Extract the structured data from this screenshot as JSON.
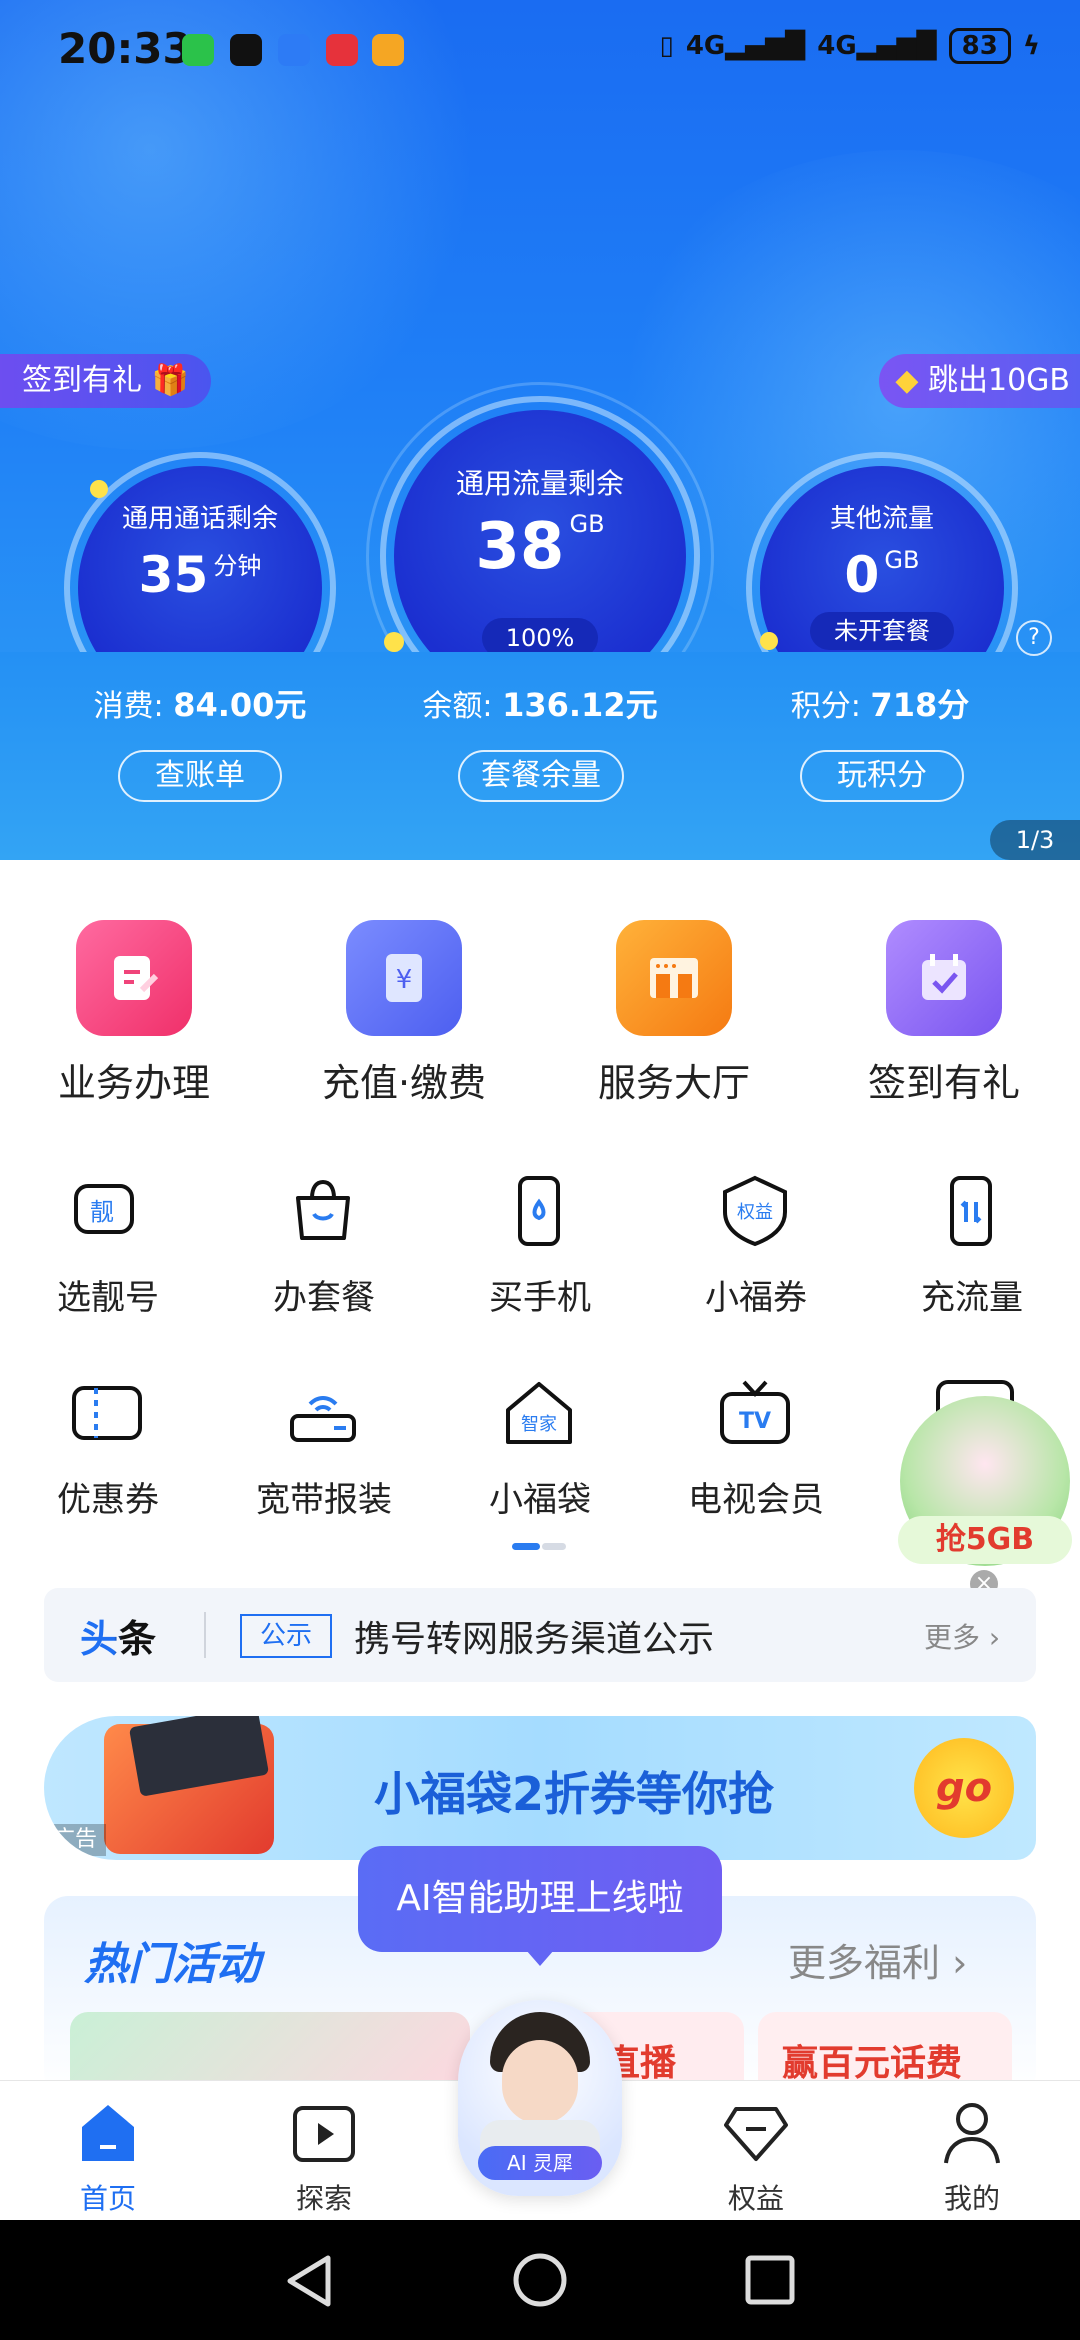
{
  "status_bar": {
    "time": "20:33",
    "net1": "4G",
    "net2": "4G",
    "battery": "83"
  },
  "hero": {
    "checkin_pill": "签到有礼",
    "jump_pill": "跳出10GB",
    "gauges": [
      {
        "title": "通用通话剩余",
        "value": "35",
        "unit": "分钟",
        "stat_label": "消费:",
        "stat_value": "84.00元",
        "button": "查账单"
      },
      {
        "title": "通用流量剩余",
        "value": "38",
        "unit": "GB",
        "badge": "100%",
        "stat_label": "余额:",
        "stat_value": "136.12元",
        "button": "套餐余量"
      },
      {
        "title": "其他流量",
        "value": "0",
        "unit": "GB",
        "badge": "未开套餐",
        "stat_label": "积分:",
        "stat_value": "718分",
        "button": "玩积分"
      }
    ],
    "pager": "1/3",
    "help": "?"
  },
  "main_services": [
    {
      "label": "业务办理",
      "icon": "edit-doc-icon",
      "color": "#f0447a"
    },
    {
      "label": "充值·缴费",
      "icon": "yen-card-icon",
      "color": "#6a7cf5"
    },
    {
      "label": "服务大厅",
      "icon": "store-icon",
      "color": "#f58a1e"
    },
    {
      "label": "签到有礼",
      "icon": "calendar-check-icon",
      "color": "#8b6af2"
    }
  ],
  "grid_row1": [
    {
      "label": "选靓号",
      "icon": "pretty-number-icon",
      "glyph": "靓"
    },
    {
      "label": "办套餐",
      "icon": "shopping-bag-icon",
      "glyph": ""
    },
    {
      "label": "买手机",
      "icon": "phone-icon",
      "glyph": ""
    },
    {
      "label": "小福券",
      "icon": "benefit-badge-icon",
      "glyph": "权益"
    },
    {
      "label": "充流量",
      "icon": "data-recharge-icon",
      "glyph": ""
    }
  ],
  "grid_row2": [
    {
      "label": "优惠券",
      "icon": "coupon-icon",
      "glyph": ""
    },
    {
      "label": "宽带报装",
      "icon": "router-icon",
      "glyph": ""
    },
    {
      "label": "小福袋",
      "icon": "smart-home-icon",
      "glyph": "智家"
    },
    {
      "label": "电视会员",
      "icon": "tv-icon",
      "glyph": "TV"
    }
  ],
  "floating_promo": {
    "label": "抢5GB",
    "close": "×"
  },
  "headline": {
    "tag": "头条",
    "badge": "公示",
    "text": "携号转网服务渠道公示",
    "more": "更多"
  },
  "ad_banner": {
    "text": "小福袋2折券等你抢",
    "go": "go",
    "ad_tag": "广告"
  },
  "hot_section": {
    "title": "热门活动",
    "more": "更多福利",
    "tooltip": "AI智能助理上线啦",
    "card2": "直播",
    "card3": "赢百元话费"
  },
  "assistant": {
    "label": "AI 灵犀"
  },
  "tabbar": [
    {
      "label": "首页",
      "icon": "home-icon",
      "active": true
    },
    {
      "label": "探索",
      "icon": "play-icon",
      "active": false
    },
    {
      "label": "权益",
      "icon": "diamond-icon",
      "active": false
    },
    {
      "label": "我的",
      "icon": "user-icon",
      "active": false
    }
  ],
  "colors": {
    "brand": "#1f6ff2",
    "active_tab": "#1f6ff2"
  }
}
